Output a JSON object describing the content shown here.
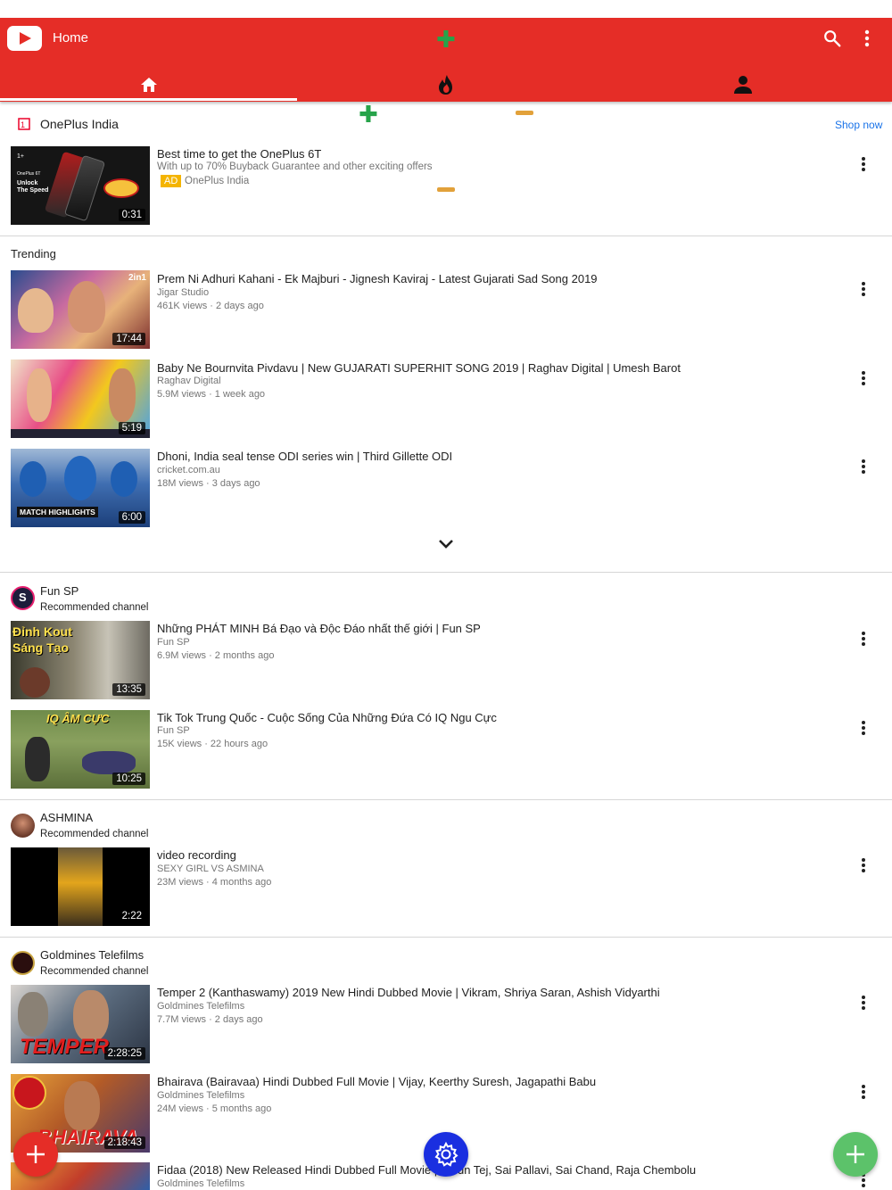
{
  "header": {
    "title": "Home",
    "tabs": [
      {
        "name": "home-tab",
        "icon": "home-icon"
      },
      {
        "name": "trending-tab",
        "icon": "flame-icon"
      },
      {
        "name": "account-tab",
        "icon": "person-icon"
      }
    ],
    "colors": {
      "bar": "#e52d27"
    }
  },
  "ad": {
    "brand": "OnePlus India",
    "shop_now": "Shop now",
    "title": "Best time to get the OnePlus 6T",
    "description": "With up to 70% Buyback Guarantee and other exciting offers",
    "badge": "AD",
    "advertiser": "OnePlus India",
    "duration": "0:31",
    "thumb_text_1": "OnePlus 6T",
    "thumb_text_2": "Unlock",
    "thumb_text_3": "The Speed"
  },
  "trending": {
    "label": "Trending",
    "videos": [
      {
        "title": "Prem Ni Adhuri Kahani - Ek Majburi - Jignesh Kaviraj - Latest Gujarati Sad Song 2019",
        "channel": "Jigar Studio",
        "meta": "461K views · 2 days ago",
        "duration": "17:44"
      },
      {
        "title": "Baby Ne Bournvita Pivdavu | New GUJARATI SUPERHIT SONG 2019 | Raghav Digital | Umesh Barot",
        "channel": "Raghav Digital",
        "meta": "5.9M views · 1 week ago",
        "duration": "5:19"
      },
      {
        "title": "Dhoni, India seal tense ODI series win | Third Gillette ODI",
        "channel": "cricket.com.au",
        "meta": "18M views · 3 days ago",
        "duration": "6:00",
        "thumb_caption": "MATCH HIGHLIGHTS"
      }
    ]
  },
  "channels": [
    {
      "name": "Fun SP",
      "subtitle": "Recommended channel",
      "videos": [
        {
          "title": "Những PHÁT MINH Bá Đạo và Độc Đáo nhất thế giới | Fun SP",
          "channel": "Fun SP",
          "meta": "6.9M views · 2 months ago",
          "duration": "13:35",
          "thumb_caption": "Đỉnh Kout Sáng Tạo"
        },
        {
          "title": "Tik Tok Trung Quốc - Cuộc Sống Của Những Đứa Có IQ Ngu Cực",
          "channel": "Fun SP",
          "meta": "15K views · 22 hours ago",
          "duration": "10:25",
          "thumb_caption": "IQ ÂM CỰC"
        }
      ]
    },
    {
      "name": "ASHMINA",
      "subtitle": "Recommended channel",
      "videos": [
        {
          "title": "video recording",
          "channel": "SEXY GIRL VS ASMINA",
          "meta": "23M views · 4 months ago",
          "duration": "2:22"
        }
      ]
    },
    {
      "name": "Goldmines Telefilms",
      "subtitle": "Recommended channel",
      "videos": [
        {
          "title": "Temper 2 (Kanthaswamy) 2019 New Hindi Dubbed Movie | Vikram, Shriya Saran, Ashish Vidyarthi",
          "channel": "Goldmines Telefilms",
          "meta": "7.7M views · 2 days ago",
          "duration": "2:28:25",
          "thumb_caption": "TEMPER"
        },
        {
          "title": "Bhairava (Bairavaa) Hindi Dubbed Full Movie | Vijay, Keerthy Suresh, Jagapathi Babu",
          "channel": "Goldmines Telefilms",
          "meta": "24M views · 5 months ago",
          "duration": "2:18:43",
          "thumb_caption": "BHAIRAVA"
        },
        {
          "title": "Fidaa (2018) New Released Hindi Dubbed Full Movie | Varun Tej, Sai Pallavi, Sai Chand, Raja Chembolu",
          "channel": "Goldmines Telefilms"
        }
      ]
    }
  ]
}
